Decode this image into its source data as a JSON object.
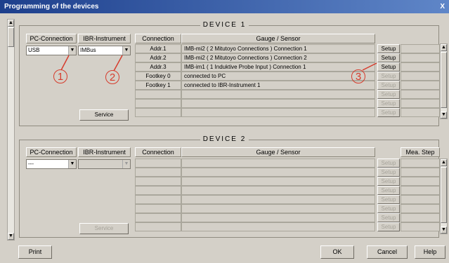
{
  "window": {
    "title": "Programming of the devices",
    "close": "X"
  },
  "device1": {
    "title": "DEVICE 1",
    "headers": {
      "pc": "PC-Connection",
      "ibr": "IBR-Instrument",
      "connection": "Connection",
      "gauge": "Gauge / Sensor"
    },
    "pc_value": "USB",
    "ibr_value": "IMBus",
    "service": "Service",
    "rows": [
      {
        "connection": "Addr.1",
        "gauge": "IMB-mi2 ( 2 Mitutoyo Connections )  Connection 1",
        "setup": "Setup",
        "setup_enabled": true
      },
      {
        "connection": "Addr.2",
        "gauge": "IMB-mi2 ( 2 Mitutoyo Connections )  Connection 2",
        "setup": "Setup",
        "setup_enabled": true
      },
      {
        "connection": "Addr.3",
        "gauge": "IMB-im1 ( 1 Induktive Probe Input )  Connection 1",
        "setup": "Setup",
        "setup_enabled": true
      },
      {
        "connection": "Footkey 0",
        "gauge": "connected to PC",
        "setup": "Setup",
        "setup_enabled": false
      },
      {
        "connection": "Footkey 1",
        "gauge": "connected to IBR-Instrument 1",
        "setup": "Setup",
        "setup_enabled": false
      },
      {
        "connection": "",
        "gauge": "",
        "setup": "Setup",
        "setup_enabled": false
      },
      {
        "connection": "",
        "gauge": "",
        "setup": "Setup",
        "setup_enabled": false
      },
      {
        "connection": "",
        "gauge": "",
        "setup": "Setup",
        "setup_enabled": false
      }
    ]
  },
  "device2": {
    "title": "DEVICE 2",
    "headers": {
      "pc": "PC-Connection",
      "ibr": "IBR-Instrument",
      "connection": "Connection",
      "gauge": "Gauge / Sensor",
      "mea": "Mea. Step"
    },
    "pc_value": "---",
    "ibr_value": "",
    "service": "Service",
    "setup": "Setup"
  },
  "annotations": {
    "c1": "1",
    "c2": "2",
    "c3": "3"
  },
  "buttons": {
    "print": "Print",
    "ok": "OK",
    "cancel": "Cancel",
    "help": "Help"
  }
}
